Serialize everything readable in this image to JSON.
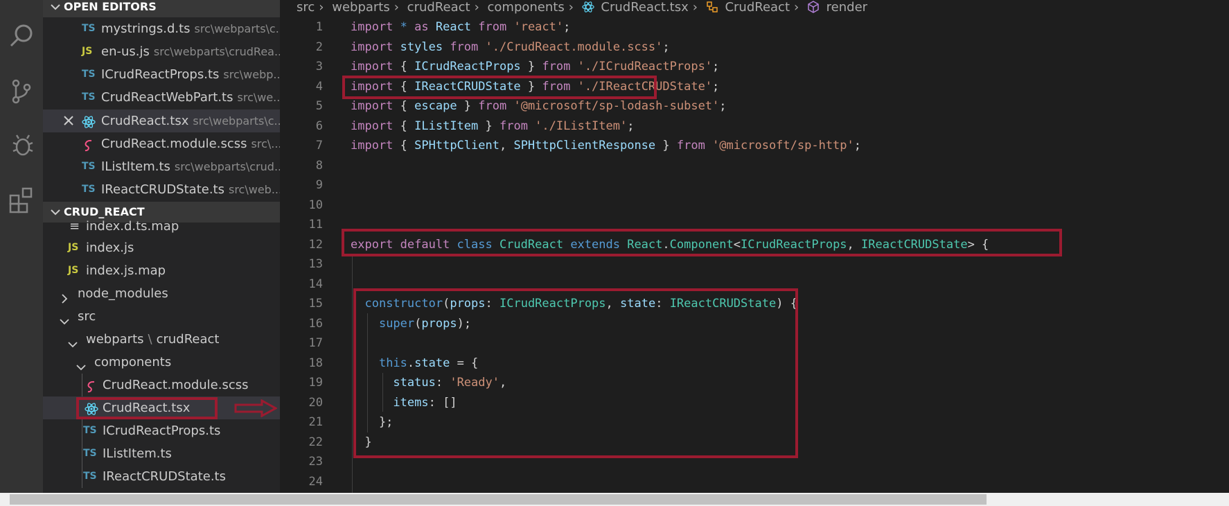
{
  "open_editors": {
    "title": "OPEN EDITORS",
    "items": [
      {
        "badge": "TS",
        "name": "mystrings.d.ts",
        "path": "src\\webparts\\c..."
      },
      {
        "badge": "JS",
        "name": "en-us.js",
        "path": "src\\webparts\\crudRea..."
      },
      {
        "badge": "TS",
        "name": "ICrudReactProps.ts",
        "path": "src\\webp..."
      },
      {
        "badge": "TS",
        "name": "CrudReactWebPart.ts",
        "path": "src\\we..."
      },
      {
        "badge": "react-icon",
        "name": "CrudReact.tsx",
        "path": "src\\webparts\\c..."
      },
      {
        "badge": "scss-icon",
        "name": "CrudReact.module.scss",
        "path": "src\\..."
      },
      {
        "badge": "TS",
        "name": "IListItem.ts",
        "path": "src\\webparts\\crud..."
      },
      {
        "badge": "TS",
        "name": "IReactCRUDState.ts",
        "path": "src\\web..."
      }
    ]
  },
  "explorer": {
    "title": "CRUD_REACT",
    "items": [
      {
        "name": "index.d.ts.map",
        "badge": "≡"
      },
      {
        "name": "index.js",
        "badge": "JS"
      },
      {
        "name": "index.js.map",
        "badge": "JS"
      },
      {
        "name": "node_modules"
      },
      {
        "name": "src"
      },
      {
        "name": "webparts",
        "sep": "\\",
        "name2": "crudReact"
      },
      {
        "name": "components"
      },
      {
        "name": "CrudReact.module.scss",
        "badge": "scss-icon"
      },
      {
        "name": "CrudReact.tsx",
        "badge": "react-icon"
      },
      {
        "name": "ICrudReactProps.ts",
        "badge": "TS"
      },
      {
        "name": "IListItem.ts",
        "badge": "TS"
      },
      {
        "name": "IReactCRUDState.ts",
        "badge": "TS"
      }
    ]
  },
  "breadcrumb": [
    "src",
    "webparts",
    "crudReact",
    "components",
    "CrudReact.tsx",
    "CrudReact",
    "render"
  ],
  "line_numbers": [
    "1",
    "2",
    "3",
    "4",
    "5",
    "6",
    "7",
    "8",
    "9",
    "10",
    "11",
    "12",
    "13",
    "14",
    "15",
    "16",
    "17",
    "18",
    "19",
    "20",
    "21",
    "22",
    "23",
    "24"
  ],
  "code": [
    [
      [
        "kw",
        "import "
      ],
      [
        "kb",
        "* "
      ],
      [
        "kw",
        "as "
      ],
      [
        "var",
        "React "
      ],
      [
        "kw",
        "from "
      ],
      [
        "str",
        "'react'"
      ],
      [
        "pl",
        ";"
      ]
    ],
    [
      [
        "kw",
        "import "
      ],
      [
        "var",
        "styles "
      ],
      [
        "kw",
        "from "
      ],
      [
        "str",
        "'./CrudReact.module.scss'"
      ],
      [
        "pl",
        ";"
      ]
    ],
    [
      [
        "kw",
        "import "
      ],
      [
        "pl",
        "{ "
      ],
      [
        "var",
        "ICrudReactProps "
      ],
      [
        "pl",
        "} "
      ],
      [
        "kw",
        "from "
      ],
      [
        "str",
        "'./ICrudReactProps'"
      ],
      [
        "pl",
        ";"
      ]
    ],
    [
      [
        "kw",
        "import "
      ],
      [
        "pl",
        "{ "
      ],
      [
        "var",
        "IReactCRUDState "
      ],
      [
        "pl",
        "} "
      ],
      [
        "kw",
        "from "
      ],
      [
        "str",
        "'./IReactCRUDState'"
      ],
      [
        "pl",
        ";"
      ]
    ],
    [
      [
        "kw",
        "import "
      ],
      [
        "pl",
        "{ "
      ],
      [
        "var",
        "escape "
      ],
      [
        "pl",
        "} "
      ],
      [
        "kw",
        "from "
      ],
      [
        "str",
        "'@microsoft/sp-lodash-subset'"
      ],
      [
        "pl",
        ";"
      ]
    ],
    [
      [
        "kw",
        "import "
      ],
      [
        "pl",
        "{ "
      ],
      [
        "var",
        "IListItem "
      ],
      [
        "pl",
        "} "
      ],
      [
        "kw",
        "from "
      ],
      [
        "str",
        "'./IListItem'"
      ],
      [
        "pl",
        ";"
      ]
    ],
    [
      [
        "kw",
        "import "
      ],
      [
        "pl",
        "{ "
      ],
      [
        "var",
        "SPHttpClient"
      ],
      [
        "pl",
        ", "
      ],
      [
        "var",
        "SPHttpClientResponse "
      ],
      [
        "pl",
        "} "
      ],
      [
        "kw",
        "from "
      ],
      [
        "str",
        "'@microsoft/sp-http'"
      ],
      [
        "pl",
        ";"
      ]
    ],
    [],
    [],
    [],
    [],
    [
      [
        "kw",
        "export default "
      ],
      [
        "kb",
        "class "
      ],
      [
        "cls",
        "CrudReact "
      ],
      [
        "kb",
        "extends "
      ],
      [
        "cls",
        "React"
      ],
      [
        "pl",
        "."
      ],
      [
        "cls",
        "Component"
      ],
      [
        "pl",
        "<"
      ],
      [
        "cls",
        "ICrudReactProps"
      ],
      [
        "pl",
        ", "
      ],
      [
        "cls",
        "IReactCRUDState"
      ],
      [
        "pl",
        "> {"
      ]
    ],
    [],
    [],
    [
      [
        "pl",
        "  "
      ],
      [
        "kb",
        "constructor"
      ],
      [
        "pl",
        "("
      ],
      [
        "var",
        "props"
      ],
      [
        "pl",
        ": "
      ],
      [
        "cls",
        "ICrudReactProps"
      ],
      [
        "pl",
        ", "
      ],
      [
        "var",
        "state"
      ],
      [
        "pl",
        ": "
      ],
      [
        "cls",
        "IReactCRUDState"
      ],
      [
        "pl",
        ") {"
      ]
    ],
    [
      [
        "pl",
        "    "
      ],
      [
        "kb",
        "super"
      ],
      [
        "pl",
        "("
      ],
      [
        "var",
        "props"
      ],
      [
        "pl",
        ");"
      ]
    ],
    [],
    [
      [
        "pl",
        "    "
      ],
      [
        "kb",
        "this"
      ],
      [
        "pl",
        "."
      ],
      [
        "var",
        "state "
      ],
      [
        "pl",
        "= {"
      ]
    ],
    [
      [
        "pl",
        "      "
      ],
      [
        "var",
        "status"
      ],
      [
        "pl",
        ": "
      ],
      [
        "str",
        "'Ready'"
      ],
      [
        "pl",
        ","
      ]
    ],
    [
      [
        "pl",
        "      "
      ],
      [
        "var",
        "items"
      ],
      [
        "pl",
        ": []"
      ]
    ],
    [
      [
        "pl",
        "    };"
      ]
    ],
    [
      [
        "pl",
        "  }"
      ]
    ],
    [],
    []
  ]
}
